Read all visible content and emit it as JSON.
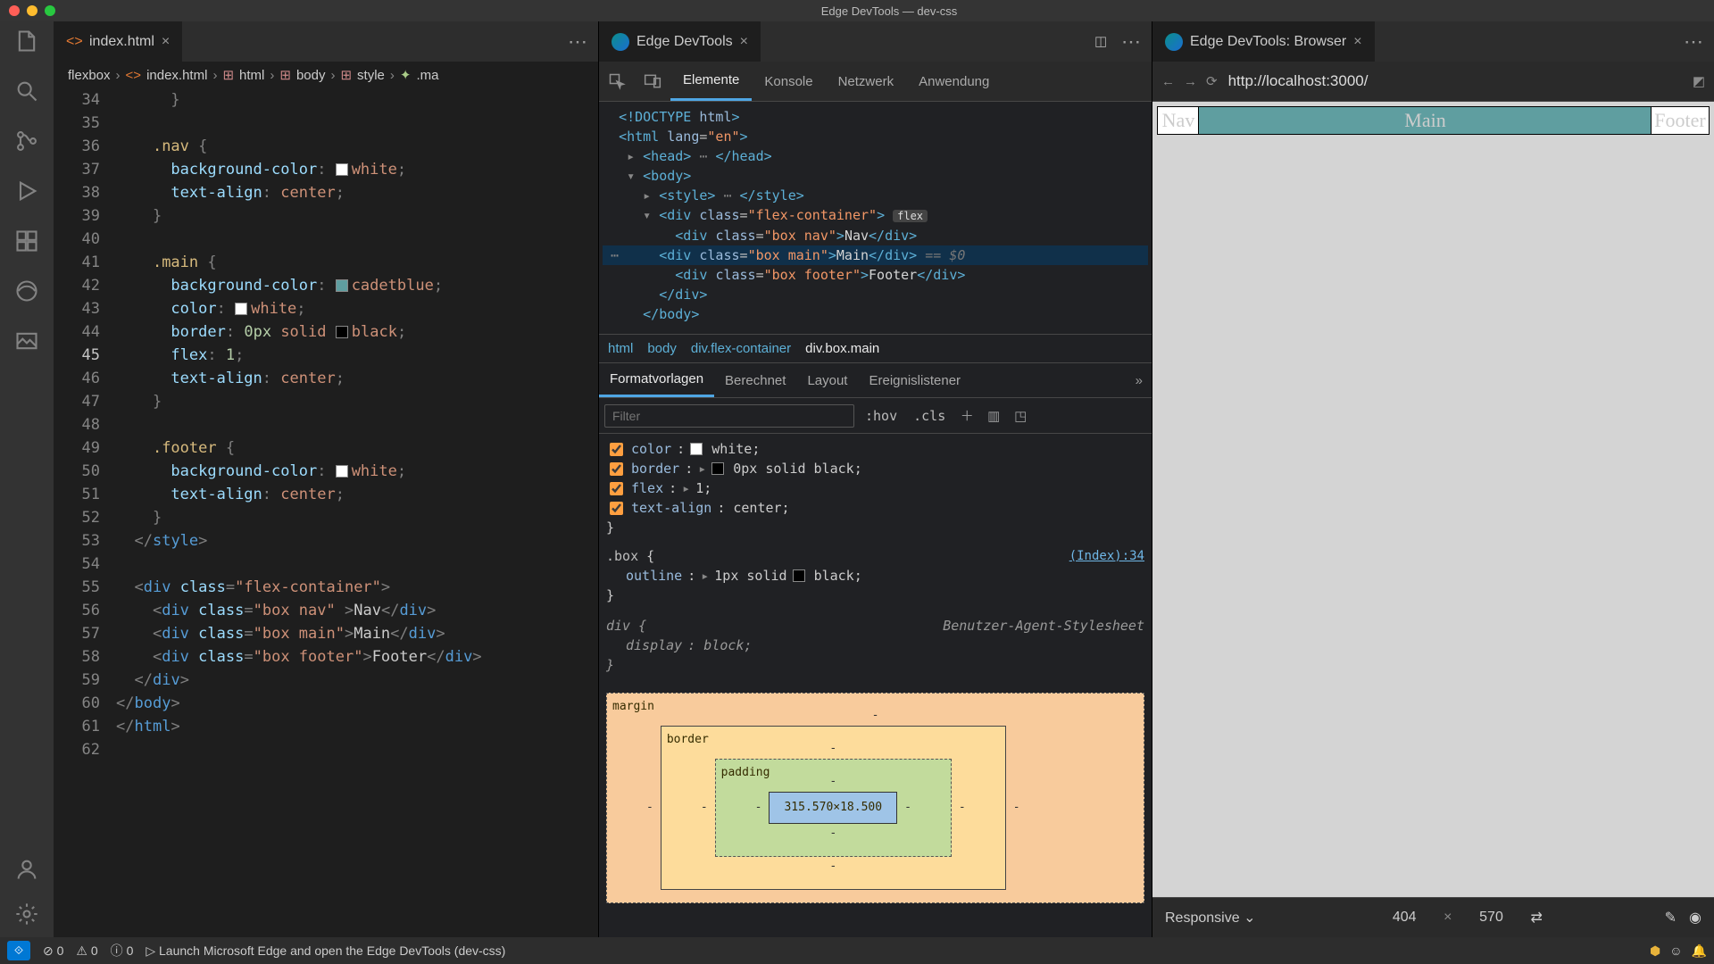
{
  "window": {
    "title": "Edge DevTools — dev-css"
  },
  "tabs": {
    "editor": {
      "label": "index.html"
    },
    "devtools": {
      "label": "Edge DevTools"
    },
    "browser": {
      "label": "Edge DevTools: Browser"
    }
  },
  "breadcrumb": [
    "flexbox",
    "index.html",
    "html",
    "body",
    "style",
    ".ma"
  ],
  "editor_lines": [
    {
      "n": 34,
      "html": "      <span class='pn'>}</span>"
    },
    {
      "n": 35,
      "html": ""
    },
    {
      "n": 36,
      "html": "    <span class='sel'>.nav</span> <span class='pn'>{</span>"
    },
    {
      "n": 37,
      "html": "      <span class='prop'>background-color</span><span class='pn'>:</span> <span class='sw' style='background:white'></span><span class='val'>white</span><span class='pn'>;</span>"
    },
    {
      "n": 38,
      "html": "      <span class='prop'>text-align</span><span class='pn'>:</span> <span class='val'>center</span><span class='pn'>;</span>"
    },
    {
      "n": 39,
      "html": "    <span class='pn'>}</span>"
    },
    {
      "n": 40,
      "html": ""
    },
    {
      "n": 41,
      "html": "    <span class='sel'>.main</span> <span class='pn'>{</span>"
    },
    {
      "n": 42,
      "html": "      <span class='prop'>background-color</span><span class='pn'>:</span> <span class='sw' style='background:#5f9ea0'></span><span class='val'>cadetblue</span><span class='pn'>;</span>"
    },
    {
      "n": 43,
      "html": "      <span class='prop'>color</span><span class='pn'>:</span> <span class='sw' style='background:white'></span><span class='val'>white</span><span class='pn'>;</span>"
    },
    {
      "n": 44,
      "html": "      <span class='prop'>border</span><span class='pn'>:</span> <span class='num'>0px</span> <span class='val'>solid</span> <span class='sw' style='background:black'></span><span class='val'>black</span><span class='pn'>;</span>"
    },
    {
      "n": 45,
      "html": "      <span class='prop'>flex</span><span class='pn'>:</span> <span class='num'>1</span><span class='pn'>;</span>",
      "hl": true
    },
    {
      "n": 46,
      "html": "      <span class='prop'>text-align</span><span class='pn'>:</span> <span class='val'>center</span><span class='pn'>;</span>"
    },
    {
      "n": 47,
      "html": "    <span class='pn'>}</span>"
    },
    {
      "n": 48,
      "html": ""
    },
    {
      "n": 49,
      "html": "    <span class='sel'>.footer</span> <span class='pn'>{</span>"
    },
    {
      "n": 50,
      "html": "      <span class='prop'>background-color</span><span class='pn'>:</span> <span class='sw' style='background:white'></span><span class='val'>white</span><span class='pn'>;</span>"
    },
    {
      "n": 51,
      "html": "      <span class='prop'>text-align</span><span class='pn'>:</span> <span class='val'>center</span><span class='pn'>;</span>"
    },
    {
      "n": 52,
      "html": "    <span class='pn'>}</span>"
    },
    {
      "n": 53,
      "html": "  <span class='pn'>&lt;/</span><span class='tg'>style</span><span class='pn'>&gt;</span>"
    },
    {
      "n": 54,
      "html": ""
    },
    {
      "n": 55,
      "html": "  <span class='pn'>&lt;</span><span class='tg'>div</span> <span class='prop'>class</span><span class='pn'>=</span><span class='str'>\"flex-container\"</span><span class='pn'>&gt;</span>"
    },
    {
      "n": 56,
      "html": "    <span class='pn'>&lt;</span><span class='tg'>div</span> <span class='prop'>class</span><span class='pn'>=</span><span class='str'>\"box nav\"</span> <span class='pn'>&gt;</span>Nav<span class='pn'>&lt;/</span><span class='tg'>div</span><span class='pn'>&gt;</span>"
    },
    {
      "n": 57,
      "html": "    <span class='pn'>&lt;</span><span class='tg'>div</span> <span class='prop'>class</span><span class='pn'>=</span><span class='str'>\"box main\"</span><span class='pn'>&gt;</span>Main<span class='pn'>&lt;/</span><span class='tg'>div</span><span class='pn'>&gt;</span>"
    },
    {
      "n": 58,
      "html": "    <span class='pn'>&lt;</span><span class='tg'>div</span> <span class='prop'>class</span><span class='pn'>=</span><span class='str'>\"box footer\"</span><span class='pn'>&gt;</span>Footer<span class='pn'>&lt;/</span><span class='tg'>div</span><span class='pn'>&gt;</span>"
    },
    {
      "n": 59,
      "html": "  <span class='pn'>&lt;/</span><span class='tg'>div</span><span class='pn'>&gt;</span>"
    },
    {
      "n": 60,
      "html": "<span class='pn'>&lt;/</span><span class='tg'>body</span><span class='pn'>&gt;</span>"
    },
    {
      "n": 61,
      "html": "<span class='pn'>&lt;/</span><span class='tg'>html</span><span class='pn'>&gt;</span>"
    },
    {
      "n": 62,
      "html": ""
    }
  ],
  "devtools": {
    "tabs": [
      "Elemente",
      "Konsole",
      "Netzwerk",
      "Anwendung"
    ],
    "active_tab": 0,
    "dom_crumb": [
      "html",
      "body",
      "div.flex-container",
      "div.box.main"
    ],
    "styles_tabs": [
      "Formatvorlagen",
      "Berechnet",
      "Layout",
      "Ereignislistener"
    ],
    "styles_active": 0,
    "filter_placeholder": "Filter",
    "hov": ":hov",
    "cls": ".cls",
    "rule_source": "(Index):34",
    "ua_label": "Benutzer-Agent-Stylesheet",
    "declarations": [
      {
        "prop": "color",
        "val": "white",
        "swatch": "#ffffff"
      },
      {
        "prop": "border",
        "val": "0px solid  black",
        "swatch": "#000000",
        "expand": true
      },
      {
        "prop": "flex",
        "val": "1",
        "expand": true
      },
      {
        "prop": "text-align",
        "val": "center"
      }
    ],
    "box_rule_sel": ".box",
    "box_decl": {
      "prop": "outline",
      "val": "1px solid  black",
      "swatch": "#000000"
    },
    "div_rule_sel": "div",
    "div_decl": {
      "prop": "display",
      "val": "block"
    },
    "box_model": {
      "labels": {
        "margin": "margin",
        "border": "border",
        "padding": "padding"
      },
      "content": "315.570×18.500"
    }
  },
  "browser": {
    "url": "http://localhost:3000/",
    "cells": {
      "nav": "Nav",
      "main": "Main",
      "footer": "Footer"
    },
    "device": {
      "name": "Responsive",
      "w": "404",
      "h": "570"
    }
  },
  "status": {
    "errors": "0",
    "warnings": "0",
    "infos": "0",
    "launch_hint": "Launch Microsoft Edge and open the Edge DevTools (dev-css)"
  }
}
